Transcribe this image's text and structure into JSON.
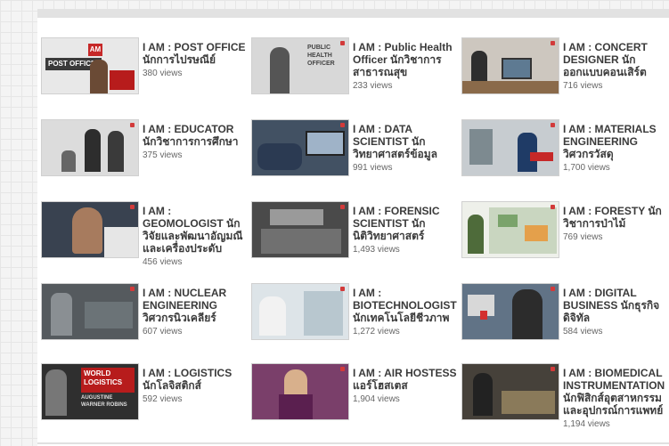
{
  "videos": [
    {
      "title": "I AM : POST OFFICE นักการไปรษณีย์",
      "views": "380 views",
      "thumb": "post-office-thumbnail"
    },
    {
      "title": "I AM : Public Health Officer นักวิชาการสาธารณสุข",
      "views": "233 views",
      "thumb": "public-health-thumbnail"
    },
    {
      "title": "I AM : CONCERT DESIGNER นักออกแบบคอนเสิร์ต",
      "views": "716 views",
      "thumb": "concert-designer-thumbnail"
    },
    {
      "title": "I AM : EDUCATOR นักวิชาการการศึกษา",
      "views": "375 views",
      "thumb": "educator-thumbnail"
    },
    {
      "title": "I AM : DATA SCIENTIST นักวิทยาศาสตร์ข้อมูล",
      "views": "991 views",
      "thumb": "data-scientist-thumbnail"
    },
    {
      "title": "I AM : MATERIALS ENGINEERING วิศวกรวัสดุ",
      "views": "1,700 views",
      "thumb": "materials-engineering-thumbnail"
    },
    {
      "title": "I AM : GEOMOLOGIST นักวิจัยและพัฒนาอัญมณีและเครื่องประดับ",
      "views": "456 views",
      "thumb": "geomologist-thumbnail"
    },
    {
      "title": "I AM : FORENSIC SCIENTIST นักนิติวิทยาศาสตร์",
      "views": "1,493 views",
      "thumb": "forensic-scientist-thumbnail"
    },
    {
      "title": "I AM : FORESTY นักวิชาการป่าไม้",
      "views": "769 views",
      "thumb": "foresty-thumbnail"
    },
    {
      "title": "I AM : NUCLEAR ENGINEERING วิศวกรนิวเคลียร์",
      "views": "607 views",
      "thumb": "nuclear-engineering-thumbnail"
    },
    {
      "title": "I AM : BIOTECHNOLOGIST นักเทคโนโลยีชีวภาพ",
      "views": "1,272 views",
      "thumb": "biotechnologist-thumbnail"
    },
    {
      "title": "I AM : DIGITAL BUSINESS นักธุรกิจดิจิทัล",
      "views": "584 views",
      "thumb": "digital-business-thumbnail"
    },
    {
      "title": "I AM : LOGISTICS นักโลจิสติกส์",
      "views": "592 views",
      "thumb": "logistics-thumbnail"
    },
    {
      "title": "I AM : AIR HOSTESS แอร์โฮสเตส",
      "views": "1,904 views",
      "thumb": "air-hostess-thumbnail"
    },
    {
      "title": "I AM : BIOMEDICAL INSTRUMENTATION นักฟิสิกส์อุตสาหกรรมและอุปกรณ์การแพทย์",
      "views": "1,194 views",
      "thumb": "biomedical-instrumentation-thumbnail"
    }
  ],
  "thumb_overlays": {
    "post_office": "POST OFFICE",
    "post_office_badge": "AM",
    "public_health": "PUBLIC HEALTH OFFICER",
    "logistics": "WORLD LOGISTICS",
    "logistics_sub": "AUGUSTINE WARNER ROBINS"
  }
}
